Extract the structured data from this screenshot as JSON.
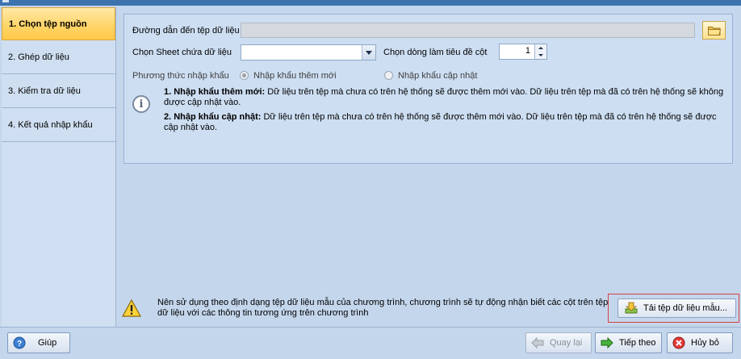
{
  "sidebar": {
    "items": [
      {
        "label": "1. Chọn tệp nguồn"
      },
      {
        "label": "2. Ghép dữ liệu"
      },
      {
        "label": "3. Kiểm tra dữ liệu"
      },
      {
        "label": "4. Kết quả nhập khẩu"
      }
    ]
  },
  "form": {
    "path_label": "Đường dẫn đến tệp dữ liệu",
    "path_value": "",
    "sheet_label": "Chọn Sheet chứa dữ liệu",
    "sheet_value": "",
    "header_row_label": "Chọn dòng làm tiêu đề cột",
    "header_row_value": "1",
    "import_method_label": "Phương thức nhập khẩu",
    "option_new": "Nhập khẩu thêm mới",
    "option_update": "Nhập khẩu cập nhật"
  },
  "info": {
    "new_title": "1. Nhập khẩu thêm mới:",
    "new_text": " Dữ liệu trên tệp mà chưa có trên hệ thống sẽ được thêm mới vào. Dữ liệu trên tệp mà đã có trên hệ thống sẽ không được cập nhật vào.",
    "update_title": "2. Nhập khẩu cập nhật:",
    "update_text": " Dữ liệu trên tệp mà chưa có trên hệ thống sẽ được thêm mới vào. Dữ liệu trên tệp mà đã có trên hệ thống sẽ được cập nhật vào."
  },
  "hint": {
    "text": "Nên sử dụng theo định dạng tệp dữ liệu mẫu của chương trình, chương trình sẽ tự động nhận biết các cột trên tệp dữ liệu với các thông tin tương ứng trên chương trình",
    "download_label": "Tải tệp dữ liệu mẫu..."
  },
  "footer": {
    "help": "Giúp",
    "back": "Quay lại",
    "next": "Tiếp theo",
    "cancel": "Hủy bỏ"
  },
  "colors": {
    "background": "#c4d6ec",
    "active_tab": "#ffd56a",
    "highlight_frame": "#d64040"
  }
}
